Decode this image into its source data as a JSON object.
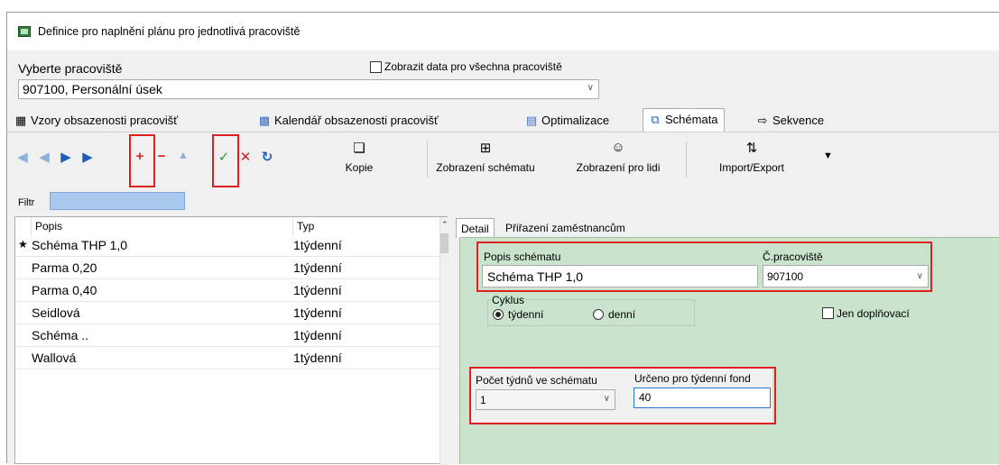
{
  "window": {
    "title": "Definice pro naplnění plánu pro jednotlivá pracoviště"
  },
  "workplace": {
    "label": "Vyberte pracoviště",
    "value": "907100, Personální úsek",
    "show_all_label": "Zobrazit data pro všechna pracoviště",
    "show_all_checked": false
  },
  "tabs": [
    {
      "label": "Vzory obsazenosti pracovišť",
      "icon": "grid-icon"
    },
    {
      "label": "Kalendář obsazenosti pracovišť",
      "icon": "calendar-icon"
    },
    {
      "label": "Optimalizace",
      "icon": "optimize-icon"
    },
    {
      "label": "Schémata",
      "icon": "schema-icon",
      "selected": true
    },
    {
      "label": "Sekvence",
      "icon": "sequence-icon"
    }
  ],
  "toolbar": {
    "nav_first": "first-record-icon",
    "nav_prev": "previous-record-icon",
    "nav_next": "next-record-icon",
    "nav_last": "last-record-icon",
    "add": "+",
    "delete": "−",
    "up": "up-icon",
    "confirm": "✓",
    "cancel": "✕",
    "refresh": "refresh-icon",
    "copy_label": "Kopie",
    "show_schema_label": "Zobrazení schématu",
    "show_people_label": "Zobrazení pro lidi",
    "import_export_label": "Import/Export"
  },
  "filter": {
    "label": "Filtr",
    "value": ""
  },
  "grid": {
    "columns": [
      "Popis",
      "Typ"
    ],
    "rows": [
      {
        "popis": "Schéma THP 1,0",
        "typ": "1týdenní",
        "current": true
      },
      {
        "popis": "Parma 0,20",
        "typ": "1týdenní"
      },
      {
        "popis": "Parma 0,40",
        "typ": "1týdenní"
      },
      {
        "popis": "Seidlová",
        "typ": "1týdenní"
      },
      {
        "popis": "Schéma ..",
        "typ": "1týdenní"
      },
      {
        "popis": "Wallová",
        "typ": "1týdenní"
      }
    ],
    "current_marker": "★"
  },
  "detail_tabs": [
    "Detail",
    "Přiřazení zaměstnancům"
  ],
  "detail": {
    "popis_label": "Popis schématu",
    "popis_value": "Schéma THP 1,0",
    "pracoviste_label": "Č.pracoviště",
    "pracoviste_value": "907100",
    "cyklus_label": "Cyklus",
    "cyklus_options": [
      "týdenní",
      "denní"
    ],
    "cyklus_selected": "týdenní",
    "jen_dopl_label": "Jen doplňovací",
    "jen_dopl_checked": false,
    "weeks_label": "Počet týdnů ve schématu",
    "weeks_value": "1",
    "fund_label": "Určeno pro týdenní fond",
    "fund_value": "40"
  },
  "colors": {
    "highlight": "#e02020",
    "detail_bg": "#c9e3cc",
    "filter_bg": "#a9c8ee",
    "nav_blue": "#1f5fb8"
  }
}
